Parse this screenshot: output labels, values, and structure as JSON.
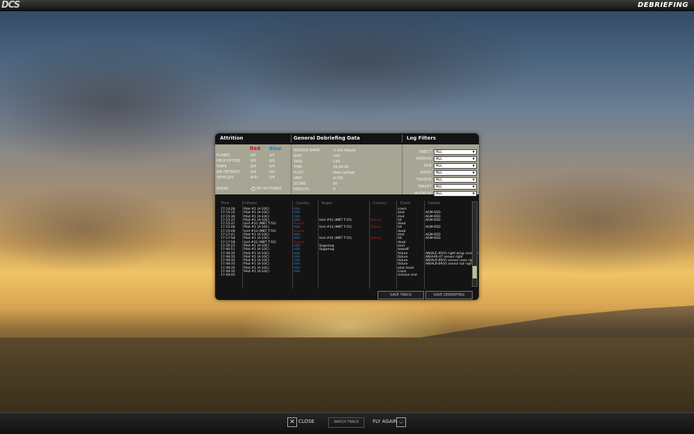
{
  "app": {
    "logo": "DCS",
    "title": "DEBRIEFING"
  },
  "bottom": {
    "close": "CLOSE",
    "watch_track": "WATCH TRACK",
    "fly_again": "FLY AGAIN"
  },
  "panel": {
    "attrition": {
      "title": "Attrition",
      "red": "Red",
      "blue": "Blue",
      "rows": [
        {
          "label": "PLANES",
          "red": "0/0",
          "blue": "2/2"
        },
        {
          "label": "HELICOPTERS",
          "red": "0/0",
          "blue": "0/0"
        },
        {
          "label": "SHIPS",
          "red": "0/0",
          "blue": "0/0"
        },
        {
          "label": "AIR DEFENCE",
          "red": "0/4",
          "blue": "0/0"
        },
        {
          "label": "VEHICLES",
          "red": "8/47",
          "blue": "0/4"
        }
      ],
      "show_label": "SHOW:",
      "my_victories": "MY VICTORIES"
    },
    "general": {
      "title": "General Debriefing Data",
      "rows": [
        {
          "label": "MISSION NAME:",
          "value": "In the Weeds"
        },
        {
          "label": "SIDE:",
          "value": "USA"
        },
        {
          "label": "TASK:",
          "value": "CAS"
        },
        {
          "label": "TIME:",
          "value": "16:30:00"
        },
        {
          "label": "PILOT:",
          "value": "New callsign"
        },
        {
          "label": "UNIT:",
          "value": "A-10C"
        },
        {
          "label": "SCORE:",
          "value": "60"
        },
        {
          "label": "RESULTS:",
          "value": "0"
        }
      ]
    },
    "filters": {
      "title": "Log Filters",
      "rows": [
        {
          "label": "OBJECT",
          "value": "ALL"
        },
        {
          "label": "WEAPON",
          "value": "ALL"
        },
        {
          "label": "SIDE",
          "value": "ALL"
        },
        {
          "label": "EVENT",
          "value": "ALL"
        },
        {
          "label": "TRGSIDE",
          "value": "ALL"
        },
        {
          "label": "TARGET",
          "value": "ALL"
        },
        {
          "label": "INITIATOR",
          "value": "ALL"
        }
      ]
    },
    "log": {
      "headers": [
        "Time",
        "Initiator",
        "Country",
        "Target",
        "Country",
        "Event",
        "Details"
      ],
      "rows": [
        {
          "time": "17:14:28",
          "init": "Pilot #1 (A-10C)",
          "c1": "USA",
          "target": "",
          "c2": "",
          "event": "crash",
          "details": ""
        },
        {
          "time": "17:15:15",
          "init": "Pilot #1 (A-10C)",
          "c1": "USA",
          "target": "",
          "c2": "",
          "event": "shot",
          "details": "AGM-65D"
        },
        {
          "time": "17:15:36",
          "init": "Pilot #1 (A-10C)",
          "c1": "USA",
          "target": "",
          "c2": "",
          "event": "shot",
          "details": "AGM-65D"
        },
        {
          "time": "17:15:37",
          "init": "Pilot #1 (A-10C)",
          "c1": "USA",
          "target": "Unit #31 (MBT T-55)",
          "c2": "Russia",
          "event": "hit",
          "details": "AGM-65D"
        },
        {
          "time": "17:15:37",
          "init": "Unit #31 (MBT T-55)",
          "c1": "Russia",
          "target": "",
          "c2": "",
          "event": "dead",
          "details": ""
        },
        {
          "time": "17:15:48",
          "init": "Pilot #1 (A-10C)",
          "c1": "USA",
          "target": "Unit #33 (MBT T-55)",
          "c2": "Russia",
          "event": "hit",
          "details": "AGM-65D"
        },
        {
          "time": "17:15:48",
          "init": "Unit #33 (MBT T-55)",
          "c1": "Russia",
          "target": "",
          "c2": "",
          "event": "dead",
          "details": ""
        },
        {
          "time": "17:17:41",
          "init": "Pilot #1 (A-10C)",
          "c1": "USA",
          "target": "",
          "c2": "",
          "event": "shot",
          "details": "AGM-65D"
        },
        {
          "time": "17:17:58",
          "init": "Pilot #1 (A-10C)",
          "c1": "USA",
          "target": "Unit #32 (MBT T-55)",
          "c2": "Russia",
          "event": "hit",
          "details": "AGM-65D"
        },
        {
          "time": "17:17:58",
          "init": "Unit #32 (MBT T-55)",
          "c1": "Russia",
          "target": "",
          "c2": "",
          "event": "dead",
          "details": ""
        },
        {
          "time": "17:26:23",
          "init": "Pilot #1 (A-10C)",
          "c1": "USA",
          "target": "Soganlug",
          "c2": "",
          "event": "land",
          "details": ""
        },
        {
          "time": "17:40:51",
          "init": "Pilot #1 (A-10C)",
          "c1": "USA",
          "target": "Soganlug",
          "c2": "",
          "event": "takeoff",
          "details": ""
        },
        {
          "time": "17:49:35",
          "init": "Pilot #1 (A-10C)",
          "c1": "USA",
          "target": "",
          "c2": "",
          "event": "failure",
          "details": "AN/ALE-40(V) right wing containe"
        },
        {
          "time": "17:49:35",
          "init": "Pilot #1 (A-10C)",
          "c1": "USA",
          "target": "",
          "c2": "",
          "event": "failure",
          "details": "AN/AAR-47 sensor right"
        },
        {
          "time": "17:49:35",
          "init": "Pilot #1 (A-10C)",
          "c1": "USA",
          "target": "",
          "c2": "",
          "event": "failure",
          "details": "AN/ALR-69(V) sensor nose right"
        },
        {
          "time": "17:49:35",
          "init": "Pilot #1 (A-10C)",
          "c1": "USA",
          "target": "",
          "c2": "",
          "event": "failure",
          "details": "AN/ALR-69(V) sensor tail right"
        },
        {
          "time": "17:49:35",
          "init": "Pilot #1 (A-10C)",
          "c1": "USA",
          "target": "",
          "c2": "",
          "event": "pilot dead",
          "details": ""
        },
        {
          "time": "17:49:35",
          "init": "Pilot #1 (A-10C)",
          "c1": "USA",
          "target": "",
          "c2": "",
          "event": "crash",
          "details": ""
        },
        {
          "time": "17:49:40",
          "init": "",
          "c1": "",
          "target": "",
          "c2": "",
          "event": "mission end",
          "details": ""
        }
      ]
    },
    "save_track": "SAVE TRACK",
    "save_debriefing": "SAVE DEBRIEFING"
  },
  "colors": {
    "usa": "#2f8fe0",
    "russia": "#c0201e",
    "panel_summary": "#a7a593"
  }
}
